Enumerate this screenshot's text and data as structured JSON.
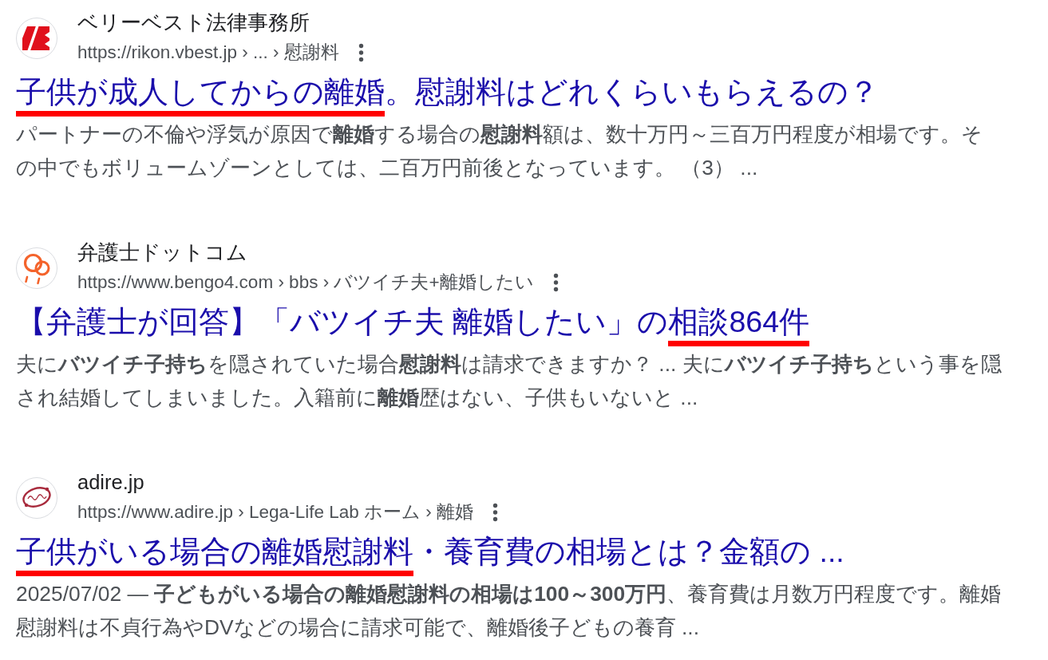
{
  "results": [
    {
      "site_name": "ベリーベスト法律事務所",
      "url": "https://rikon.vbest.jp › ... › 慰謝料",
      "title": [
        {
          "text": "子供が成人してからの離婚",
          "underlined": true
        },
        {
          "text": "。慰謝料はどれくらいもらえるの？",
          "underlined": false
        }
      ],
      "snippet": "パートナーの不倫や浮気が原因で**離婚**する場合の**慰謝料**額は、数十万円～三百万円程度が相場です。その中でもボリュームゾーンとしては、二百万円前後となっています。 （3） ..."
    },
    {
      "site_name": "弁護士ドットコム",
      "url": "https://www.bengo4.com › bbs › バツイチ夫+離婚したい",
      "title": [
        {
          "text": "【弁護士が回答】「バツイチ夫 離婚したい」の",
          "underlined": false
        },
        {
          "text": "相談864件",
          "underlined": true
        }
      ],
      "snippet": "夫に**バツイチ子持ち**を隠されていた場合**慰謝料**は請求できますか？ ... 夫に**バツイチ子持ち**という事を隠され結婚してしまいました。入籍前に**離婚**歴はない、子供もいないと ..."
    },
    {
      "site_name": "adire.jp",
      "url": "https://www.adire.jp › Lega-Life Lab ホーム › 離婚",
      "title": [
        {
          "text": "子供がいる場合の離婚慰謝料",
          "underlined": true
        },
        {
          "text": "・養育費の相場とは？金額の ...",
          "underlined": false
        }
      ],
      "snippet": "2025/07/02 — **子どもがいる場合の離婚慰謝料の相場は100～300万円**、養育費は月数万円程度です。離婚慰謝料は不貞行為やDVなどの場合に請求可能で、離婚後子どもの養育 ..."
    }
  ]
}
